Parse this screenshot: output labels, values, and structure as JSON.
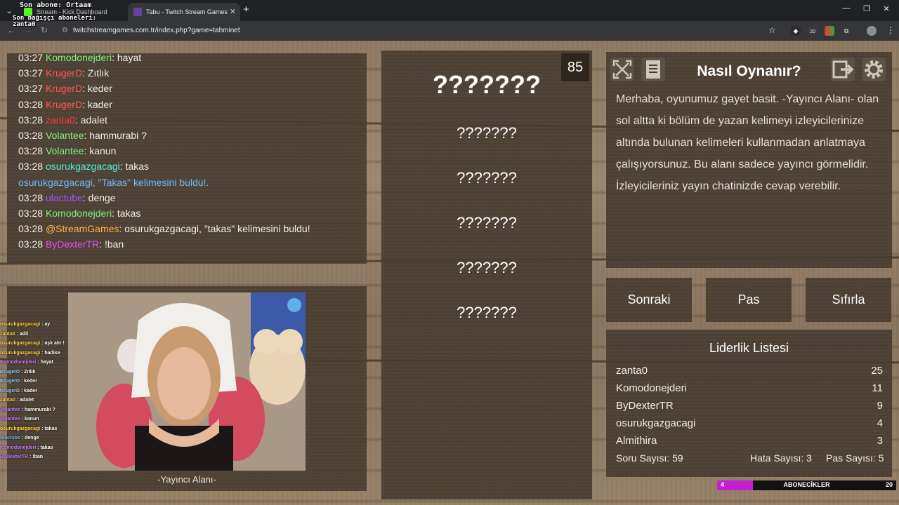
{
  "browser": {
    "tabs": [
      {
        "title": "Stream - Kick Dashboard",
        "active": false,
        "favicon_color": "#53fc18"
      },
      {
        "title": "Tabu - Twitch Stream Games",
        "active": true,
        "favicon_color": "#6441a5"
      }
    ],
    "url": "twitchstreamgames.com.tr/index.php?game=tahminet",
    "ext_badge": "20"
  },
  "overlay": {
    "last_sub": "Son abone: Ortaam",
    "last_donors_1": "Son bağışçı aboneleri:",
    "last_donors_2": "zanta0"
  },
  "chat": {
    "lines": [
      {
        "time": "03:27",
        "user": "Komodonejderi",
        "color": "#7cf07c",
        "msg": ": hayat"
      },
      {
        "time": "03:27",
        "user": "KrugerD",
        "color": "#ff5a4d",
        "msg": ": Zıtlık"
      },
      {
        "time": "03:27",
        "user": "KrugerD",
        "color": "#ff5a4d",
        "msg": ": keder"
      },
      {
        "time": "03:28",
        "user": "KrugerD",
        "color": "#ff5a4d",
        "msg": ": kader"
      },
      {
        "time": "03:28",
        "user": "zanta0",
        "color": "#ff3b3b",
        "msg": ": adalet"
      },
      {
        "time": "03:28",
        "user": "Volantee",
        "color": "#7cf07c",
        "msg": ": hammurabi ?"
      },
      {
        "time": "03:28",
        "user": "Volantee",
        "color": "#7cf07c",
        "msg": ": kanun"
      },
      {
        "time": "03:28",
        "user": "osurukgazgacagi",
        "color": "#4ff0d8",
        "msg": ": takas"
      },
      {
        "time": "",
        "user": "",
        "color": "#6fb6ff",
        "msg": "osurukgazgacagi, \"Takas\" kelimesini buldu!."
      },
      {
        "time": "03:28",
        "user": "ulactube",
        "color": "#9a55ff",
        "msg": ": denge"
      },
      {
        "time": "03:28",
        "user": "Komodonejderi",
        "color": "#7cf07c",
        "msg": ": takas"
      },
      {
        "time": "03:28",
        "user": "@StreamGames",
        "color": "#ffb347",
        "msg": ": osurukgazgacagi, \"takas\" kelimesini buldu!"
      },
      {
        "time": "03:28",
        "user": "ByDexterTR",
        "color": "#e94cf5",
        "msg": ": !ban"
      }
    ]
  },
  "cam": {
    "label": "-Yayıncı Alanı-"
  },
  "mini_chat": [
    {
      "user": "osurukgazgacagi",
      "msg": " : ay",
      "color": "#ffd54a"
    },
    {
      "user": "zanta0",
      "msg": " : adil",
      "color": "#ffd54a"
    },
    {
      "user": "osurukgazgacagi",
      "msg": " : aşk alır !",
      "color": "#ffd54a"
    },
    {
      "user": "osurukgazgacagi",
      "msg": " : hadise",
      "color": "#ffd54a"
    },
    {
      "user": "Komodonejderi",
      "msg": " : hayat",
      "color": "#c77dff"
    },
    {
      "user": "KrugerD",
      "msg": " : Zıtlık",
      "color": "#9ad0ff"
    },
    {
      "user": "KrugerD",
      "msg": " : keder",
      "color": "#9ad0ff"
    },
    {
      "user": "KrugerD",
      "msg": " : kader",
      "color": "#9ad0ff"
    },
    {
      "user": "zanta0",
      "msg": " : adalet",
      "color": "#ffd54a"
    },
    {
      "user": "Volantee",
      "msg": " : hammurabi ?",
      "color": "#c77dff"
    },
    {
      "user": "Volantee",
      "msg": " : kanun",
      "color": "#c77dff"
    },
    {
      "user": "osurukgazgacagi",
      "msg": " : takas",
      "color": "#ffd54a"
    },
    {
      "user": "ulactube",
      "msg": " : denge",
      "color": "#6fb6ff"
    },
    {
      "user": "Komodonejderi",
      "msg": " : takas",
      "color": "#c77dff"
    },
    {
      "user": "ByDexterTR",
      "msg": " : !ban",
      "color": "#c77dff"
    }
  ],
  "game": {
    "score": "85",
    "main_word": "???????",
    "taboo_words": [
      "???????",
      "???????",
      "???????",
      "???????",
      "???????"
    ]
  },
  "info": {
    "title": "Nasıl Oynanır?",
    "text": "Merhaba, oyunumuz gayet basit. -Yayıncı Alanı- olan sol altta ki bölüm de yazan kelimeyi izleyicilerinize altında bulunan kelimeleri kullanmadan anlatmaya çalışıyorsunuz. Bu alanı sadece yayıncı görmelidir. İzleyicileriniz yayın chatinizde cevap verebilir."
  },
  "buttons": {
    "next": "Sonraki",
    "pass": "Pas",
    "reset": "Sıfırla"
  },
  "leaderboard": {
    "title": "Liderlik Listesi",
    "rows": [
      {
        "name": "zanta0",
        "score": "25"
      },
      {
        "name": "Komodonejderi",
        "score": "11"
      },
      {
        "name": "ByDexterTR",
        "score": "9"
      },
      {
        "name": "osurukgazgacagi",
        "score": "4"
      },
      {
        "name": "Almithira",
        "score": "3"
      }
    ],
    "questions": "Soru Sayısı: 59",
    "errors": "Hata Sayısı: 3",
    "passes": "Pas Sayısı: 5"
  },
  "subs_goal": {
    "current": "4",
    "label": "ABONECİKLER",
    "goal": "20",
    "progress": 0.2
  }
}
